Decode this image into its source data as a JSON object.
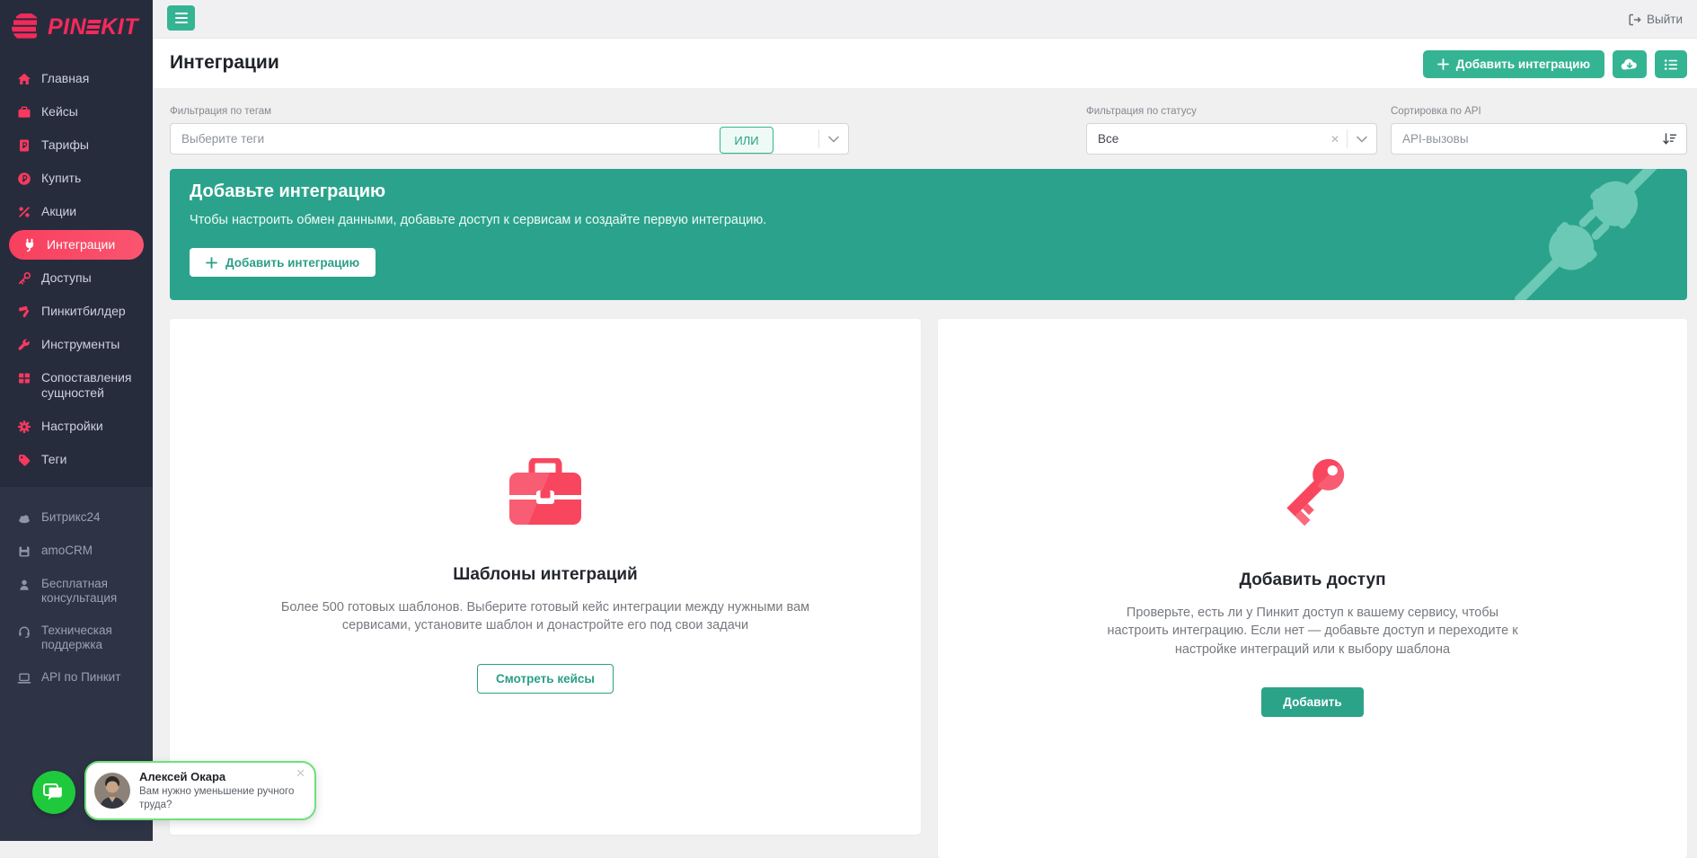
{
  "logo": {
    "part1": "PIN",
    "part2": "KIT"
  },
  "topbar": {
    "logout_label": "Выйти"
  },
  "page": {
    "title": "Интеграции"
  },
  "toolbar": {
    "add_integration_label": "Добавить интеграцию"
  },
  "filters": {
    "tags_label": "Фильтрация по тегам",
    "tags_placeholder": "Выберите теги",
    "or_label": "ИЛИ",
    "status_label": "Фильтрация по статусу",
    "status_value": "Все",
    "sort_label": "Сортировка по API",
    "sort_value": "API-вызовы"
  },
  "banner": {
    "title": "Добавьте интеграцию",
    "text": "Чтобы настроить обмен данными, добавьте доступ к сервисам и создайте первую интеграцию.",
    "button_label": "Добавить интеграцию"
  },
  "cards": [
    {
      "title": "Шаблоны интеграций",
      "text": "Более 500 готовых шаблонов. Выберите готовый кейс интеграции между нужными вам сервисами, установите шаблон и донастройте его под свои задачи",
      "button_label": "Смотреть кейсы"
    },
    {
      "title": "Добавить доступ",
      "text": "Проверьте, есть ли у Пинкит доступ к вашему сервису, чтобы настроить интеграцию. Если нет — добавьте доступ и переходите к настройке интеграций или к выбору шаблона",
      "button_label": "Добавить"
    }
  ],
  "sidebar": {
    "main": [
      {
        "label": "Главная"
      },
      {
        "label": "Кейсы"
      },
      {
        "label": "Тарифы"
      },
      {
        "label": "Купить"
      },
      {
        "label": "Акции"
      },
      {
        "label": "Интеграции",
        "active": true
      },
      {
        "label": "Доступы"
      },
      {
        "label": "Пинкитбилдер"
      },
      {
        "label": "Инструменты"
      },
      {
        "label": "Сопоставления сущностей"
      },
      {
        "label": "Настройки"
      },
      {
        "label": "Теги"
      }
    ],
    "secondary": [
      {
        "label": "Битрикс24"
      },
      {
        "label": "amoCRM"
      },
      {
        "label": "Бесплатная консультация"
      },
      {
        "label": "Техническая поддержка"
      },
      {
        "label": "API по Пинкит"
      }
    ]
  },
  "chat": {
    "name": "Алексей Окара",
    "message": "Вам нужно уменьшение ручного труда?"
  },
  "colors": {
    "accent_pink": "#f8395f",
    "teal": "#35b493",
    "banner_teal": "#2ba38c",
    "sidebar_bg": "#272c3d",
    "sidebar_bg_secondary": "#2e3446",
    "chat_green": "#1fc93c",
    "page_bg": "#f0f0f1"
  }
}
